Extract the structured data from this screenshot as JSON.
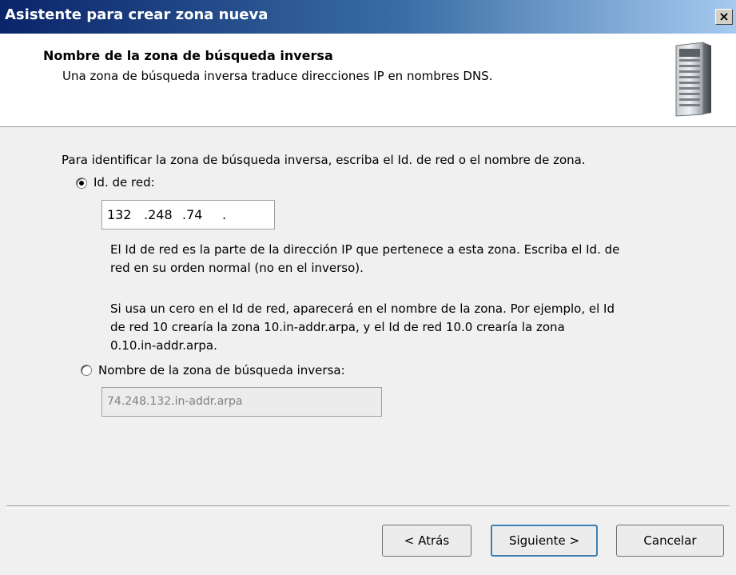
{
  "window": {
    "title": "Asistente para crear zona nueva",
    "close_glyph": "×"
  },
  "header": {
    "title": "Nombre de la zona de búsqueda inversa",
    "subtitle": "Una zona de búsqueda inversa traduce direcciones IP en nombres DNS.",
    "icon": "server-icon"
  },
  "body": {
    "instruction": "Para identificar la zona de búsqueda inversa, escriba el Id. de red o el nombre de zona.",
    "network_id": {
      "label": "Id. de red:",
      "selected": true,
      "segments": [
        "132",
        ".248",
        ".74",
        "."
      ],
      "help_line1": "El Id de red es la parte de la dirección IP que pertenece a esta zona. Escriba el Id. de",
      "help_line2": "red en su orden normal (no en el inverso).",
      "zero_line1": "Si usa un cero en el Id de red, aparecerá en el nombre de la zona.  Por ejemplo, el Id",
      "zero_line2": "de red 10 crearía la zona 10.in-addr.arpa, y el Id de red 10.0 crearía la zona",
      "zero_line3": "0.10.in-addr.arpa."
    },
    "zone_name": {
      "label": "Nombre de la zona de búsqueda inversa:",
      "selected": false,
      "value": "74.248.132.in-addr.arpa"
    }
  },
  "buttons": {
    "back": "< Atrás",
    "next": "Siguiente >",
    "cancel": "Cancelar"
  }
}
